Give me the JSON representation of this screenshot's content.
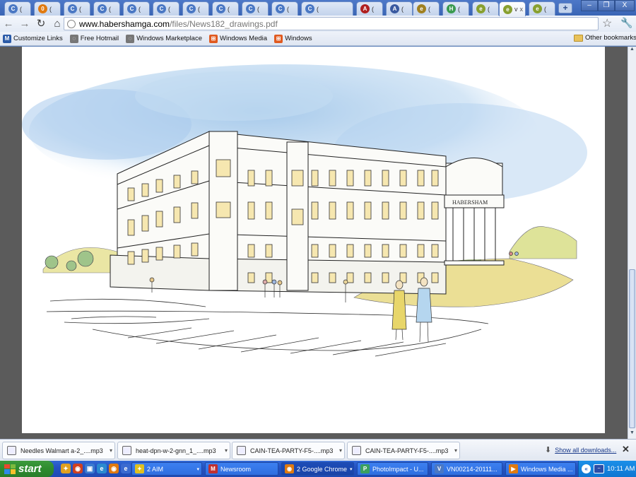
{
  "browser": {
    "tabs": [
      {
        "title": "(",
        "fav": "#4a78c4",
        "glyph": "C"
      },
      {
        "title": "(",
        "fav": "#e07a10",
        "glyph": "0"
      },
      {
        "title": "(",
        "fav": "#4a78c4",
        "glyph": "C"
      },
      {
        "title": "(",
        "fav": "#4a78c4",
        "glyph": "C"
      },
      {
        "title": "(",
        "fav": "#4a78c4",
        "glyph": "C"
      },
      {
        "title": "(",
        "fav": "#4a78c4",
        "glyph": "C"
      },
      {
        "title": "(",
        "fav": "#4a78c4",
        "glyph": "C"
      },
      {
        "title": "(",
        "fav": "#4a78c4",
        "glyph": "C"
      },
      {
        "title": "(",
        "fav": "#4a78c4",
        "glyph": "C"
      },
      {
        "title": "(",
        "fav": "#4a78c4",
        "glyph": "C"
      },
      {
        "title": "(",
        "fav": "#4a78c4",
        "glyph": "C"
      },
      {
        "title": "(",
        "fav": "#b02020",
        "glyph": "A"
      },
      {
        "title": "(",
        "fav": "#3a5aa0",
        "glyph": "A"
      },
      {
        "title": "(",
        "fav": "#a08020",
        "glyph": "e"
      },
      {
        "title": "(",
        "fav": "#3a9a50",
        "glyph": "H"
      },
      {
        "title": "(",
        "fav": "#88a030",
        "glyph": "e"
      },
      {
        "title": "v",
        "fav": "#88a030",
        "glyph": "e",
        "active": true
      },
      {
        "title": "(",
        "fav": "#88a030",
        "glyph": "e"
      }
    ],
    "close_glyph": "x",
    "new_tab": "+",
    "window_buttons": {
      "min": "–",
      "max": "❐",
      "close": "X"
    },
    "url": {
      "host": "www.habershamga.com",
      "path": "/files/News182_drawings.pdf"
    },
    "toolbar": {
      "back": "←",
      "forward": "→",
      "reload": "↻",
      "home": "⌂",
      "star": "☆",
      "wrench": "🔧"
    },
    "bookmarks": [
      {
        "label": "Customize Links",
        "color": "#2a5aa8",
        "glyph": "M"
      },
      {
        "label": "Free Hotmail",
        "color": "#777777",
        "glyph": "◌"
      },
      {
        "label": "Windows Marketplace",
        "color": "#777777",
        "glyph": "◌"
      },
      {
        "label": "Windows Media",
        "color": "#e05a20",
        "glyph": "⊞"
      },
      {
        "label": "Windows",
        "color": "#e05a20",
        "glyph": "⊞"
      }
    ],
    "other_bookmarks": "Other bookmarks"
  },
  "document": {
    "building_sign": "HABERSHAM"
  },
  "downloads": {
    "items": [
      {
        "name": "Needles Walmart a-2_....mp3"
      },
      {
        "name": "heat-dpn-w-2-gnn_1_....mp3"
      },
      {
        "name": "CAIN-TEA-PARTY-F5-....mp3"
      },
      {
        "name": "CAIN-TEA-PARTY-F5-....mp3"
      }
    ],
    "show_all": "Show all downloads...",
    "close": "✕",
    "arrow": "▾"
  },
  "taskbar": {
    "start": "start",
    "quicklaunch": [
      {
        "color": "#e0a020",
        "glyph": "✦"
      },
      {
        "color": "#d04020",
        "glyph": "◉"
      },
      {
        "color": "#3a7ad0",
        "glyph": "▣"
      },
      {
        "color": "#2a8ad0",
        "glyph": "e"
      },
      {
        "color": "#e07a10",
        "glyph": "◉"
      },
      {
        "color": "#3a6ad0",
        "glyph": "e"
      }
    ],
    "tasks": [
      {
        "label": "2 AIM",
        "color": "#e0c020",
        "glyph": "✦",
        "arrow": "▾"
      },
      {
        "label": "Newsroom",
        "color": "#c03030",
        "glyph": "M",
        "arrow": ""
      },
      {
        "label": "2 Google Chrome",
        "color": "#e07a10",
        "glyph": "◉",
        "arrow": "▾",
        "active": true
      },
      {
        "label": "PhotoImpact - U...",
        "color": "#3aa060",
        "glyph": "P",
        "arrow": ""
      },
      {
        "label": "VN00214-20111...",
        "color": "#4a78c4",
        "glyph": "V",
        "arrow": ""
      },
      {
        "label": "Windows Media ...",
        "color": "#e07a10",
        "glyph": "▶",
        "arrow": ""
      }
    ],
    "tray_chevron": "«",
    "tray_icon": "~",
    "clock": "10:11 AM"
  }
}
